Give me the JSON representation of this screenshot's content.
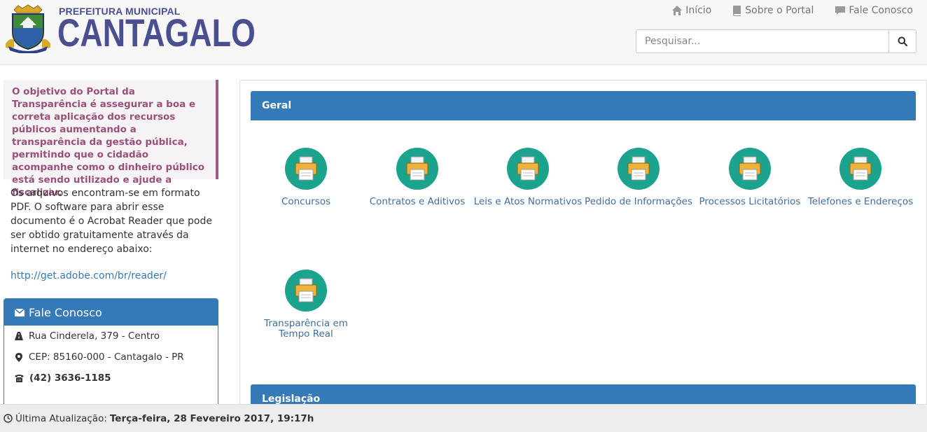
{
  "header": {
    "brand_top": "PREFEITURA MUNICIPAL",
    "brand_main": "CANTAGALO",
    "nav": [
      {
        "label": "Início",
        "icon": "home-icon"
      },
      {
        "label": "Sobre o Portal",
        "icon": "book-icon"
      },
      {
        "label": "Fale Conosco",
        "icon": "comment-icon"
      }
    ],
    "search": {
      "placeholder": "Pesquisar...",
      "icon": "search-icon"
    }
  },
  "sidebar": {
    "intro": "O objetivo do Portal da Transparência é assegurar a boa e correta aplicação dos recursos públicos aumentando a transparência da gestão pública, permitindo que o cidadão acompanhe como o dinheiro público está sendo utilizado e ajude a fiscalizar.",
    "pdf_text": "Os arquivos encontram-se em formato PDF. O software para abrir esse documento é o Acrobat Reader que pode ser obtido gratuitamente através da internet no endereço abaixo:",
    "adobe_link": "http://get.adobe.com/br/reader/",
    "contact": {
      "title": "Fale Conosco",
      "address": "Rua Cinderela, 379 - Centro",
      "cep": "CEP: 85160-000 - Cantagalo - PR",
      "phone": "(42) 3636-1185"
    }
  },
  "main": {
    "sections": [
      {
        "title": "Geral",
        "items": [
          {
            "label": "Concursos"
          },
          {
            "label": "Contratos e Aditivos"
          },
          {
            "label": "Leis e Atos Normativos"
          },
          {
            "label": "Pedido de Informações"
          },
          {
            "label": "Processos Licitatórios"
          },
          {
            "label": "Telefones e Endereços"
          },
          {
            "label": "Transparência em Tempo Real"
          }
        ]
      },
      {
        "title": "Legislação"
      }
    ]
  },
  "footer": {
    "label": "Última Atualização:",
    "value": "Terça-feira, 28 Fevereiro 2017, 19:17h"
  },
  "colors": {
    "brand": "#4a4f8f",
    "primary": "#337ab7",
    "intro_text": "#9b4f7b",
    "tile_circle": "#1ba38d",
    "tile_printer": "#f0b23a"
  }
}
